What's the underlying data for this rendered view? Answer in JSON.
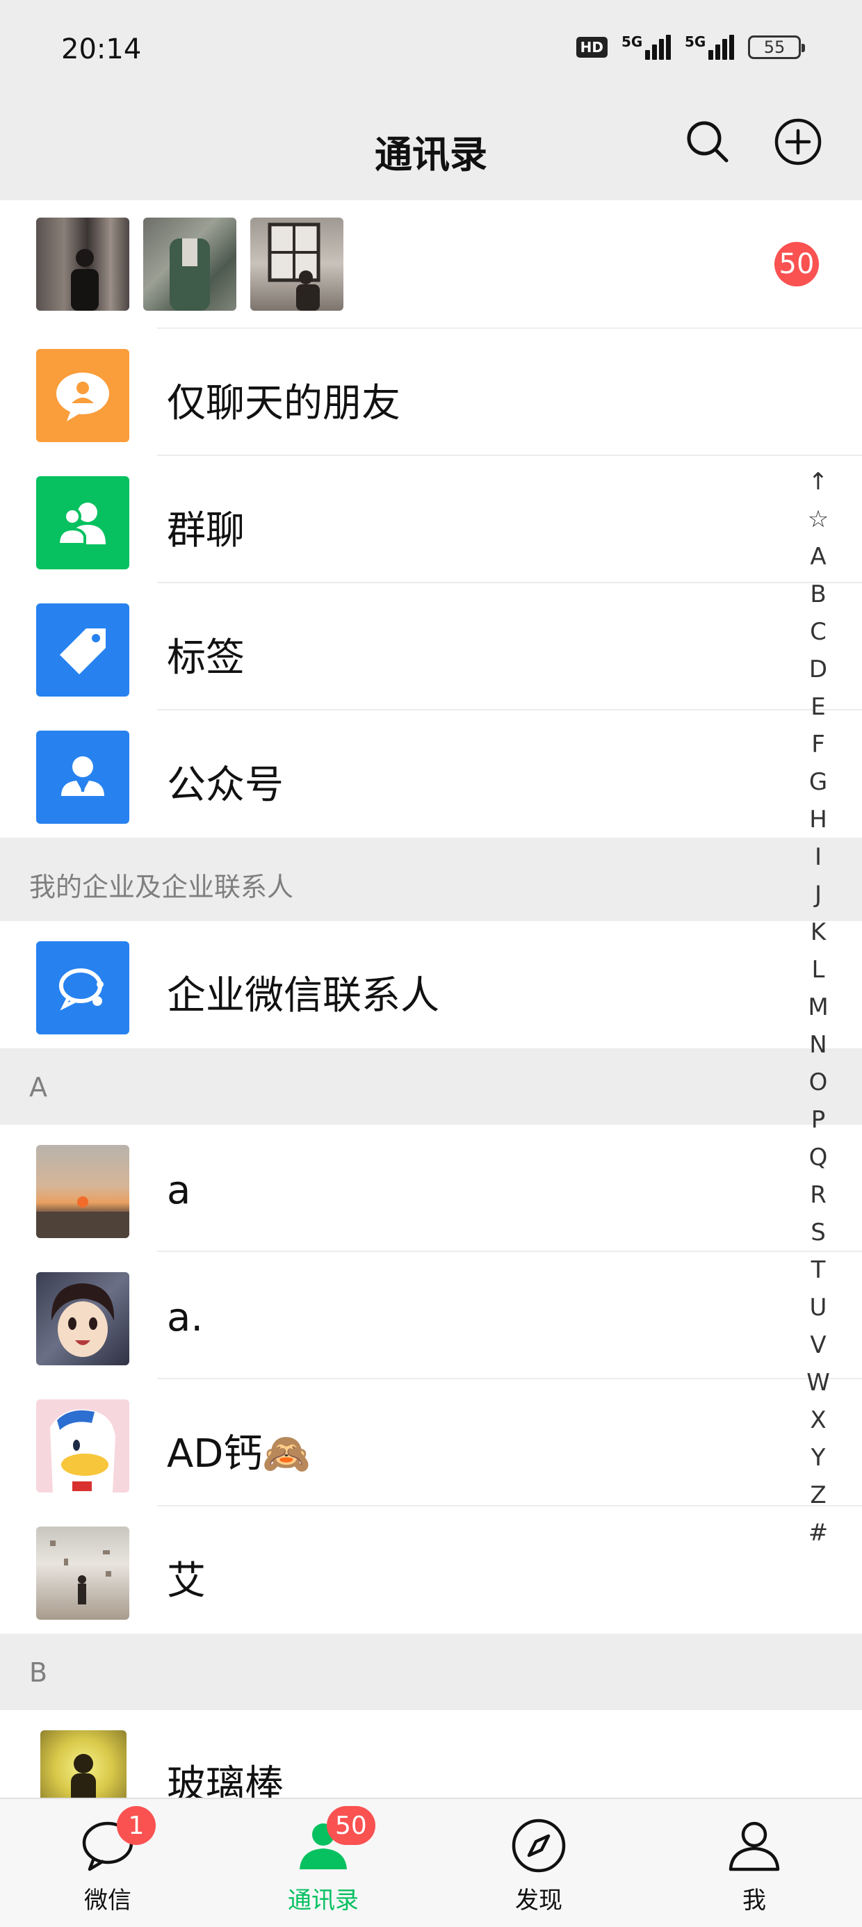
{
  "status_bar": {
    "time": "20:14",
    "hd": "HD",
    "network_1": "5G",
    "network_2": "5G",
    "battery": "55"
  },
  "header": {
    "title": "通讯录",
    "search_icon": "search-icon",
    "add_icon": "plus-circle-icon"
  },
  "top_row": {
    "new_friends_count": "50",
    "thumbnails": [
      "avatar-photo-1",
      "avatar-photo-2",
      "avatar-photo-3"
    ]
  },
  "menu": [
    {
      "label": "仅聊天的朋友",
      "icon": "chat-only-friend-icon",
      "color": "#fa9d3b"
    },
    {
      "label": "群聊",
      "icon": "group-chat-icon",
      "color": "#07c160"
    },
    {
      "label": "标签",
      "icon": "tag-icon",
      "color": "#2782f0"
    },
    {
      "label": "公众号",
      "icon": "official-account-icon",
      "color": "#2782f0"
    }
  ],
  "enterprise": {
    "header": "我的企业及企业联系人",
    "label": "企业微信联系人",
    "icon": "wecom-icon",
    "color": "#2782f0"
  },
  "sections": [
    {
      "letter": "A",
      "contacts": [
        "a",
        "a.",
        "AD钙🙈",
        "艾"
      ]
    },
    {
      "letter": "B",
      "contacts": [
        "玻璃棒"
      ]
    }
  ],
  "index_letters": [
    "↑",
    "☆",
    "A",
    "B",
    "C",
    "D",
    "E",
    "F",
    "G",
    "H",
    "I",
    "J",
    "K",
    "L",
    "M",
    "N",
    "O",
    "P",
    "Q",
    "R",
    "S",
    "T",
    "U",
    "V",
    "W",
    "X",
    "Y",
    "Z",
    "#"
  ],
  "tabs": [
    {
      "label": "微信",
      "icon": "chat-bubble-icon",
      "badge": "1"
    },
    {
      "label": "通讯录",
      "icon": "contacts-icon",
      "badge": "50",
      "active": true
    },
    {
      "label": "发现",
      "icon": "compass-icon"
    },
    {
      "label": "我",
      "icon": "person-icon"
    }
  ],
  "colors": {
    "accent": "#07c160",
    "badge": "#fa5151",
    "background": "#ededed"
  }
}
